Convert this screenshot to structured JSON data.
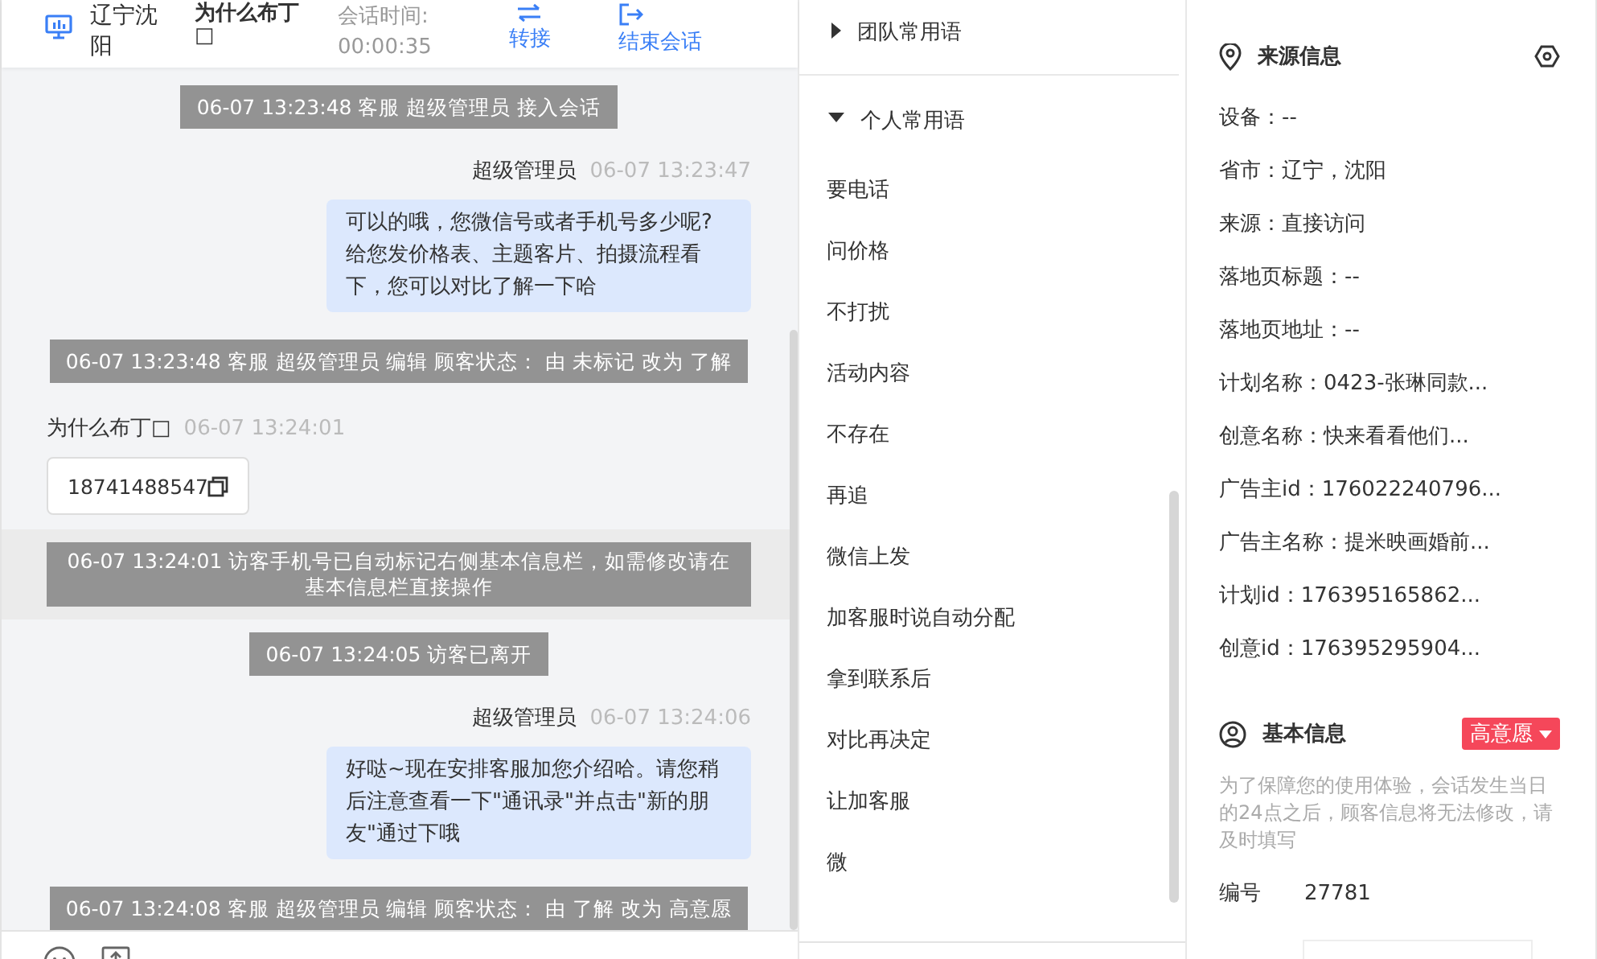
{
  "header": {
    "location": "辽宁沈阳",
    "visitor": "为什么布丁□",
    "duration_label": "会话时间:",
    "duration": "00:00:35",
    "actions": [
      {
        "kind": "transfer",
        "label": "转接"
      },
      {
        "kind": "end",
        "label": "结束会话"
      }
    ]
  },
  "messages": [
    {
      "kind": "system",
      "text": "06-07 13:23:48 客服 超级管理员 接入会话",
      "highlighted": false
    },
    {
      "kind": "agent",
      "sender": "超级管理员",
      "time": "06-07 13:23:47",
      "text": "可以的哦，您微信号或者手机号多少呢?给您发价格表、主题客片、拍摄流程看下，您可以对比了解一下哈"
    },
    {
      "kind": "system",
      "text": "06-07 13:23:48 客服 超级管理员 编辑 顾客状态： 由 未标记 改为 了解",
      "highlighted": false
    },
    {
      "kind": "visitor",
      "sender": "为什么布丁□",
      "time": "06-07 13:24:01",
      "text": "18741488547"
    },
    {
      "kind": "system",
      "text": "06-07 13:24:01 访客手机号已自动标记右侧基本信息栏，如需修改请在基本信息栏直接操作",
      "highlighted": true
    },
    {
      "kind": "system",
      "text": "06-07 13:24:05 访客已离开",
      "highlighted": false
    },
    {
      "kind": "agent",
      "sender": "超级管理员",
      "time": "06-07 13:24:06",
      "text": "好哒~现在安排客服加您介绍哈。请您稍后注意查看一下\"通讯录\"并点击\"新的朋友\"通过下哦"
    },
    {
      "kind": "system",
      "text": "06-07 13:24:08 客服 超级管理员 编辑 顾客状态： 由 了解 改为 高意愿",
      "highlighted": false
    }
  ],
  "phrases": {
    "groups": [
      {
        "title": "团队常用语",
        "expanded": false
      },
      {
        "title": "个人常用语",
        "expanded": true,
        "items": [
          "要电话",
          "问价格",
          "不打扰",
          "活动内容",
          "不存在",
          "再追",
          "微信上发",
          "加客服时说自动分配",
          "拿到联系后",
          "对比再决定",
          "让加客服",
          "微"
        ]
      }
    ]
  },
  "source_info": {
    "title": "来源信息",
    "rows": [
      "设备：--",
      "省市：辽宁，沈阳",
      "来源：直接访问",
      "落地页标题：--",
      "落地页地址：--",
      "计划名称：0423-张琳同款...",
      "创意名称：快来看看他们...",
      "广告主id：176022240796...",
      "广告主名称：提米映画婚前...",
      "计划id：176395165862...",
      "创意id：176395295904..."
    ]
  },
  "basic_info": {
    "title": "基本信息",
    "tag": "高意愿",
    "note": "为了保障您的使用体验，会话发生当日的24点之后，顾客信息将无法修改，请及时填写",
    "fields": [
      {
        "label": "编号",
        "value": "27781"
      }
    ]
  }
}
